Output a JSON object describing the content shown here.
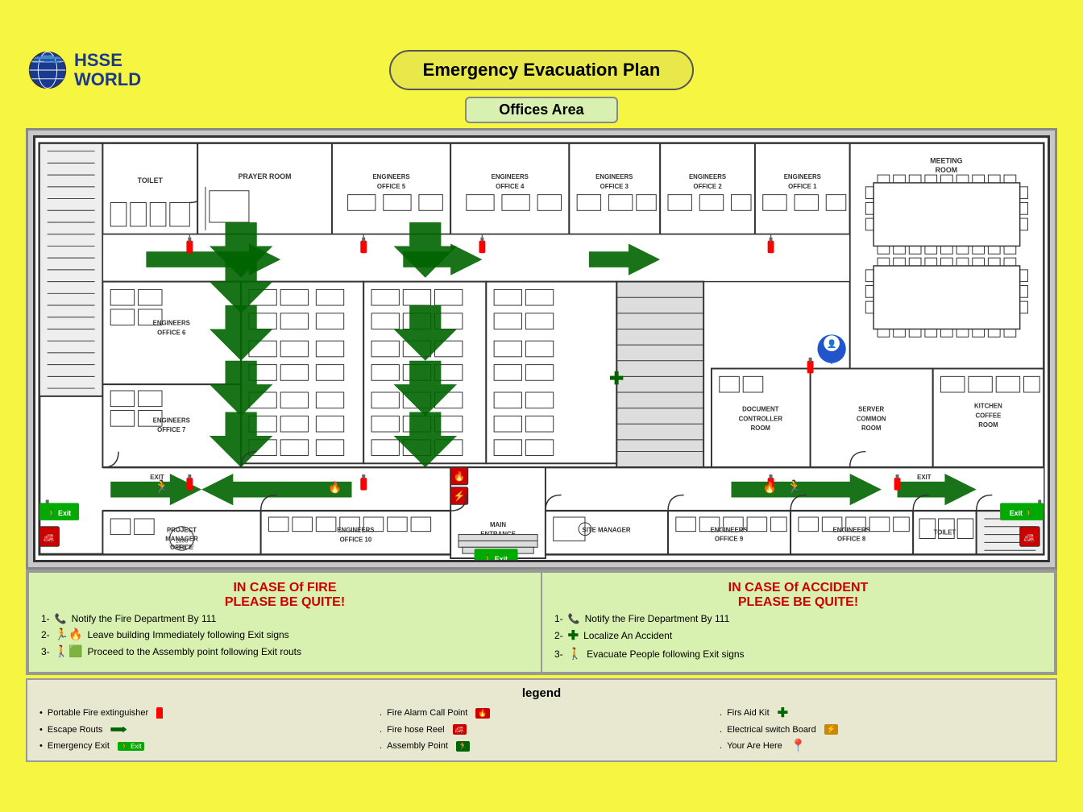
{
  "header": {
    "logo_text": "HSSE\nWORLD",
    "title": "Emergency  Evacuation Plan",
    "subtitle": "Offices Area"
  },
  "rooms": [
    {
      "id": "prayer-room",
      "label": "PRAYER ROOM"
    },
    {
      "id": "engineers-office-5",
      "label": "ENGINEERS\nOFFICE 5"
    },
    {
      "id": "engineers-office-4",
      "label": "ENGINEERS\nOFFICE 4"
    },
    {
      "id": "engineers-office-3",
      "label": "ENGINEERS\nOFFICE 3"
    },
    {
      "id": "engineers-office-2",
      "label": "ENGINEERS\nOFFICE 2"
    },
    {
      "id": "engineers-office-1",
      "label": "ENGINEERS\nOFFICE 1"
    },
    {
      "id": "meeting-room",
      "label": "MEETING\nROOM"
    },
    {
      "id": "toilet",
      "label": "TOILET"
    },
    {
      "id": "engineers-office-6",
      "label": "ENGINEERS\nOFFICE 6"
    },
    {
      "id": "engineers-office-7",
      "label": "ENGINEERS\nOFFICE 7"
    },
    {
      "id": "document-controller-room",
      "label": "DOCUMENT\nCONTROLLER\nROOM"
    },
    {
      "id": "server-common-room",
      "label": "SERVER\nCOMMON\nROOM"
    },
    {
      "id": "kitchen-coffee-room",
      "label": "KITCHEN\nCOFFEE\nROOM"
    },
    {
      "id": "project-manager-office",
      "label": "PROJECT\nMANAGER\nOFFICE"
    },
    {
      "id": "engineers-office-10",
      "label": "ENGINEERS\nOFFICE 10"
    },
    {
      "id": "site-manager",
      "label": "SITE MANAGER"
    },
    {
      "id": "engineers-office-9",
      "label": "ENGINEERS\nOFFICE 9"
    },
    {
      "id": "engineers-office-8",
      "label": "ENGINEERS\nOFFICE 8"
    },
    {
      "id": "toilet-2",
      "label": "TOILET"
    }
  ],
  "fire_instructions": {
    "title_line1": "IN CASE Of FIRE",
    "title_line2": "PLEASE BE QUITE!",
    "steps": [
      {
        "num": "1-",
        "text": "Notify the Fire Department By 111"
      },
      {
        "num": "2-",
        "text": "Leave building Immediately following  Exit signs"
      },
      {
        "num": "3-",
        "text": "Proceed to the Assembly point  following Exit routs"
      }
    ]
  },
  "accident_instructions": {
    "title_line1": "IN CASE Of ACCIDENT",
    "title_line2": "PLEASE BE QUITE!",
    "steps": [
      {
        "num": "1-",
        "text": "Notify the Fire Department By 111"
      },
      {
        "num": "2-",
        "text": "Localize An Accident"
      },
      {
        "num": "3-",
        "text": "Evacuate People following Exit signs"
      }
    ]
  },
  "legend": {
    "title": "legend",
    "items": [
      {
        "bullet": "•",
        "text": "Portable Fire extinguisher"
      },
      {
        "bullet": "•",
        "text": "Escape Routs"
      },
      {
        "bullet": "•",
        "text": "Emergency Exit"
      },
      {
        "bullet": ".",
        "text": "Fire Alarm Call Point"
      },
      {
        "bullet": ".",
        "text": "Fire hose Reel"
      },
      {
        "bullet": ".",
        "text": "Assembly Point"
      },
      {
        "bullet": ".",
        "text": "Firs Aid Kit"
      },
      {
        "bullet": ".",
        "text": "Electrical switch Board"
      },
      {
        "bullet": ".",
        "text": "Your Are Here"
      }
    ]
  },
  "exits": [
    "Exit",
    "Exit",
    "Exit",
    "Exit"
  ],
  "main_entrance": "MAIN ENTRANCE"
}
